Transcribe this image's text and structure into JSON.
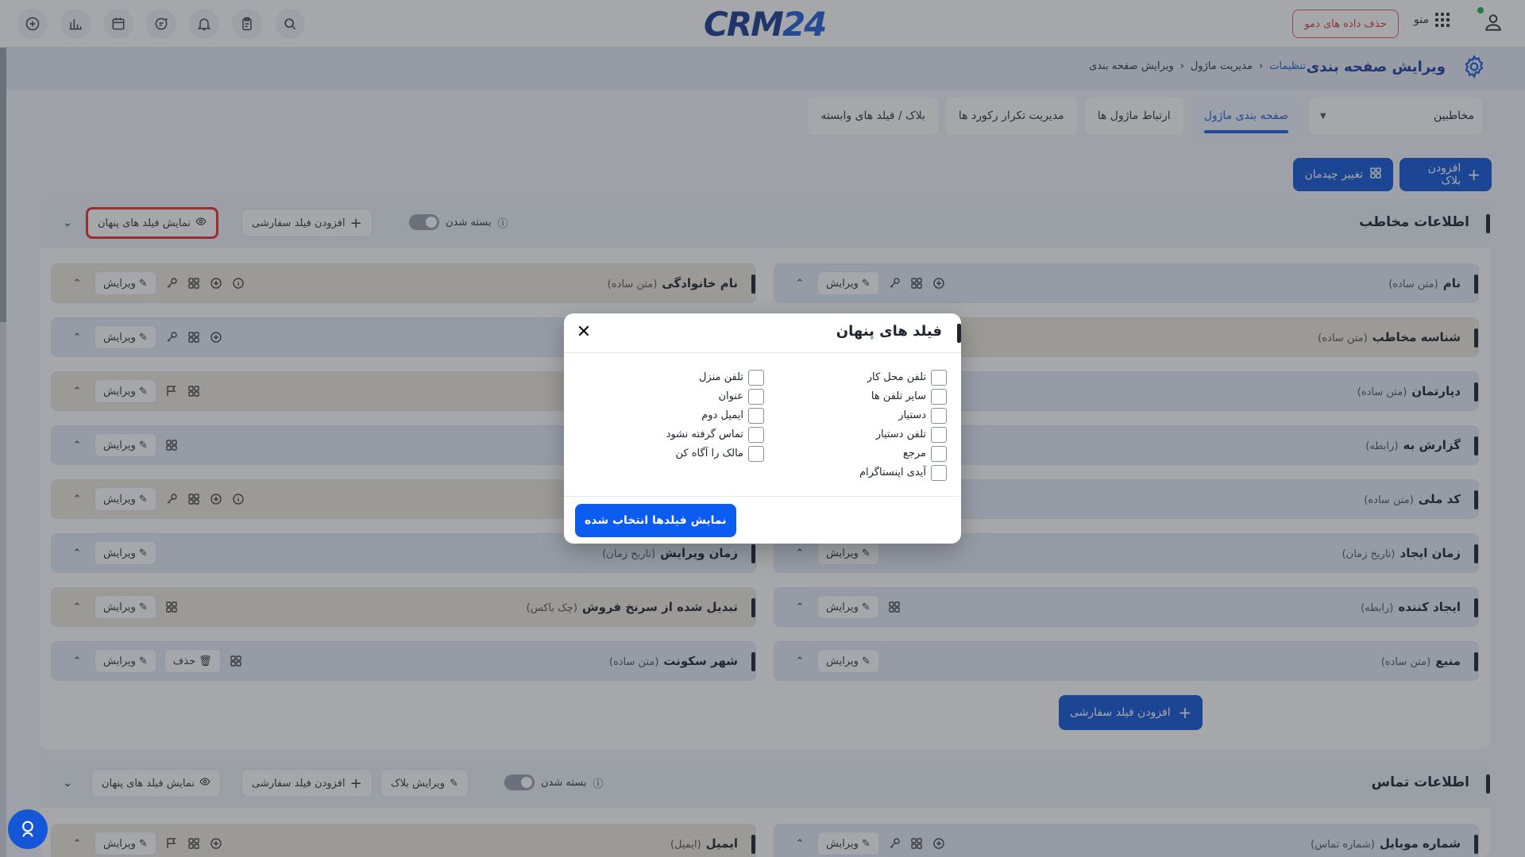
{
  "topbar": {
    "logo_text": "CRM",
    "logo_num": "24",
    "demo_button": "حذف داده های دمو",
    "menu_label": "منو",
    "left_icons": [
      "plus-icon",
      "chart-icon",
      "calendar-icon",
      "chat-icon",
      "bell-icon",
      "clipboard-icon",
      "search-icon"
    ]
  },
  "page": {
    "title": "ویرایش صفحه بندی",
    "breadcrumb": [
      "تنظیمات",
      "مدیریت ماژول",
      "ویرایش صفحه بندی"
    ]
  },
  "tabs": {
    "module_select": "مخاطبین",
    "items": [
      "صفحه بندی ماژول",
      "ارتباط ماژول ها",
      "مدیریت تکرار رکورد ها",
      "بلاک / فیلد های وابسته"
    ]
  },
  "actions": {
    "add_block": "افزودن بلاک",
    "change_layout": "تغییر چیدمان"
  },
  "block1": {
    "title": "اطلاعات مخاطب",
    "collapse_label": "بسته شدن",
    "add_custom_field": "افزودن فیلد سفارشی",
    "show_hidden_fields": "نمایش فیلد های پنهان",
    "edit_label": "ویرایش",
    "delete_label": "حذف",
    "right_fields": [
      {
        "name": "نام",
        "type": "(متن ساده)"
      },
      {
        "name": "شناسه مخاطب",
        "type": "(متن ساده)"
      },
      {
        "name": "دپارتمان",
        "type": "(متن ساده)"
      },
      {
        "name": "گزارش به",
        "type": "(رابطه)"
      },
      {
        "name": "کد ملی",
        "type": "(متن ساده)"
      },
      {
        "name": "زمان ایجاد",
        "type": "(تاریخ زمان)"
      },
      {
        "name": "ایجاد کننده",
        "type": "(رابطه)"
      },
      {
        "name": "منبع",
        "type": "(متن ساده)"
      }
    ],
    "left_fields": [
      {
        "name": "نام خانوادگی",
        "type": "(متن ساده)"
      },
      {
        "name": "",
        "type": ""
      },
      {
        "name": "",
        "type": ""
      },
      {
        "name": "",
        "type": ""
      },
      {
        "name": "",
        "type": ""
      },
      {
        "name": "زمان ویرایش",
        "type": "(تاریخ زمان)"
      },
      {
        "name": "تبدیل شده از سرنخ فروش",
        "type": "(چک باکس)"
      },
      {
        "name": "شهر سکونت",
        "type": "(متن ساده)"
      }
    ],
    "add_custom_bottom": "افزودن فیلد سفارشی"
  },
  "block2": {
    "title": "اطلاعات تماس",
    "collapse_label": "بسته شدن",
    "edit_block": "ویرایش بلاک",
    "add_custom_field": "افزودن فیلد سفارشی",
    "show_hidden_fields": "نمایش فیلد های پنهان",
    "edit_label": "ویرایش",
    "right_field": {
      "name": "شماره موبایل",
      "type": "(شماره تماس)"
    },
    "left_field": {
      "name": "ایمیل",
      "type": "(ایمیل)"
    }
  },
  "modal": {
    "title": "فیلد های پنهان",
    "right_column": [
      "تلفن محل کار",
      "سایر تلفن ها",
      "دستیار",
      "تلفن دستیار",
      "مرجع",
      "آیدی اینستاگرام"
    ],
    "left_column": [
      "تلفن منزل",
      "عنوان",
      "ایمیل دوم",
      "تماس گرفته نشود",
      "مالک را آگاه کن"
    ],
    "submit": "نمایش فیلدها انتخاب شده"
  },
  "colors": {
    "primary": "#1457d6",
    "title_blue": "#1a3da0",
    "highlight_red": "#e63232",
    "card_blue": "#e6ecf6",
    "card_beige": "#efe9db"
  }
}
